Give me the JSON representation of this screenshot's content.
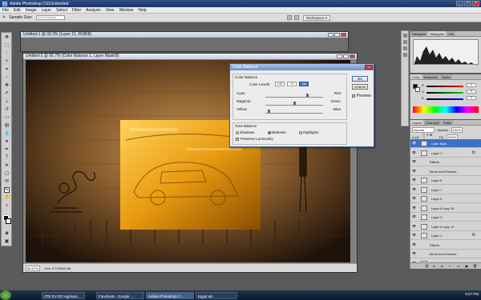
{
  "app": {
    "title": "Adobe Photoshop CS3 Extended",
    "menu": [
      "File",
      "Edit",
      "Image",
      "Layer",
      "Select",
      "Filter",
      "Analysis",
      "View",
      "Window",
      "Help"
    ]
  },
  "options": {
    "sample_size_label": "Sample Size:",
    "sample_size_value": "Point Sample",
    "workspace_label": "Workspace"
  },
  "docs": {
    "doc1_title": "Untitled-1 @ 33.3% (Layer 11, RGB/8)",
    "doc2_title": "Untitled-2 @ 66.7% (Color Balance 1, Layer Mask/8)",
    "zoom": "66.67%",
    "doc_info": "Doc: 3.71M/38.2M"
  },
  "color_balance": {
    "title": "Color Balance",
    "group_title": "Color Balance",
    "levels_label": "Color Levels:",
    "levels": [
      "+45",
      "+2",
      "-88"
    ],
    "rows": [
      {
        "left": "Cyan",
        "right": "Red",
        "value": 45
      },
      {
        "left": "Magenta",
        "right": "Green",
        "value": 2
      },
      {
        "left": "Yellow",
        "right": "Blue",
        "value": -88
      }
    ],
    "tone_title": "Tone Balance",
    "tones": [
      "Shadows",
      "Midtones",
      "Highlights"
    ],
    "selected_tone": "Midtones",
    "preserve_luminosity": "Preserve Luminosity",
    "ok": "OK",
    "cancel": "Cancel",
    "preview": "Preview"
  },
  "panels": {
    "nav_tabs": [
      "Navigator",
      "Histogram",
      "Info"
    ],
    "color_tabs": [
      "Color",
      "Swatches",
      "Styles"
    ],
    "color_labels": [
      "R",
      "G",
      "B"
    ],
    "color_values": [
      "0",
      "0",
      "0"
    ],
    "layer_tabs": [
      "Layers",
      "Channels",
      "Paths"
    ],
    "blend_mode": "Normal",
    "opacity_label": "Opacity:",
    "opacity_value": "100%",
    "fill_label": "Fill:",
    "fill_value": "100%",
    "lock_label": "Lock:"
  },
  "layers": [
    {
      "name": "Color Bala...",
      "selected": true,
      "fx": false,
      "effect": false
    },
    {
      "name": "Layer 1",
      "selected": false,
      "fx": true,
      "effect": false
    },
    {
      "name": "Effects",
      "selected": false,
      "fx": false,
      "effect": true
    },
    {
      "name": "Bevel and Emboss",
      "selected": false,
      "fx": false,
      "effect": true
    },
    {
      "name": "Layer 8",
      "selected": false,
      "fx": false,
      "effect": false
    },
    {
      "name": "Layer 7",
      "selected": false,
      "fx": false,
      "effect": false
    },
    {
      "name": "Layer 5",
      "selected": false,
      "fx": false,
      "effect": false
    },
    {
      "name": "Layer 8 copy 16",
      "selected": false,
      "fx": false,
      "effect": false
    },
    {
      "name": "Layer 3",
      "selected": false,
      "fx": false,
      "effect": false
    },
    {
      "name": "Layer 8 copy 12",
      "selected": false,
      "fx": false,
      "effect": false
    },
    {
      "name": "Layer 2",
      "selected": false,
      "fx": true,
      "effect": false
    },
    {
      "name": "Effects",
      "selected": false,
      "fx": false,
      "effect": true
    },
    {
      "name": "Bevel and Emboss",
      "selected": false,
      "fx": false,
      "effect": true
    },
    {
      "name": "Background",
      "selected": false,
      "fx": false,
      "effect": false
    }
  ],
  "taskbar": {
    "tasks": [
      "ZTE EV-DO Applicat...",
      "Facebook - Google ...",
      "Adobe Photoshop C...",
      "Egypt.aln"
    ],
    "active_index": 2,
    "clock": "9:27 PM"
  }
}
